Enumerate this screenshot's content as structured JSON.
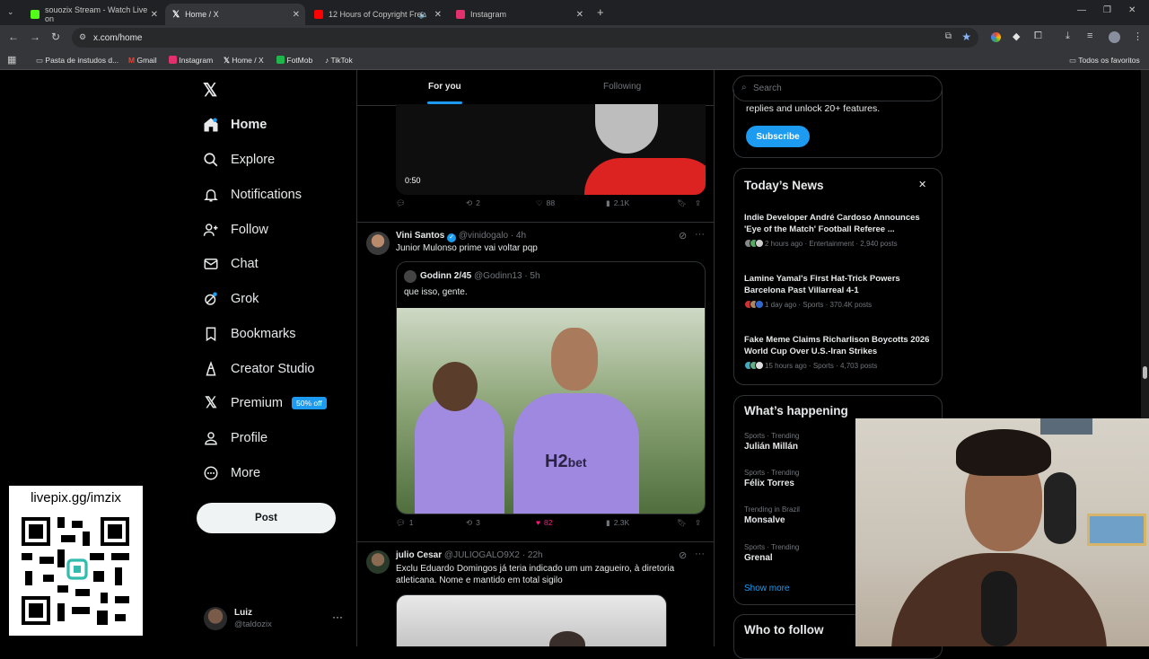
{
  "browser": {
    "tabs": [
      {
        "title": "souozix Stream - Watch Live on",
        "color": "#53fc18"
      },
      {
        "title": "Home / X",
        "color": "#ffffff"
      },
      {
        "title": "12 Hours of Copyright Free",
        "color": "#ff0000"
      },
      {
        "title": "Instagram",
        "color": "#e1306c"
      }
    ],
    "url": "x.com/home",
    "bookmarks": [
      "Pasta de instudos d...",
      "Gmail",
      "Instagram",
      "Home / X",
      "FotMob",
      "TikTok"
    ],
    "all_bookmarks": "Todos os favoritos"
  },
  "sidebar": {
    "items": [
      {
        "label": "Home",
        "icon": "home-icon"
      },
      {
        "label": "Explore",
        "icon": "search-icon"
      },
      {
        "label": "Notifications",
        "icon": "bell-icon"
      },
      {
        "label": "Follow",
        "icon": "add-user-icon"
      },
      {
        "label": "Chat",
        "icon": "mail-icon"
      },
      {
        "label": "Grok",
        "icon": "grok-icon"
      },
      {
        "label": "Bookmarks",
        "icon": "bookmark-icon"
      },
      {
        "label": "Creator Studio",
        "icon": "creator-icon"
      },
      {
        "label": "Premium",
        "icon": "x-logo-icon"
      },
      {
        "label": "Profile",
        "icon": "person-icon"
      },
      {
        "label": "More",
        "icon": "more-circle-icon"
      }
    ],
    "premium_badge": "50% off",
    "post_button": "Post",
    "user": {
      "name": "Luiz",
      "handle": "@taldozix"
    }
  },
  "overlay": {
    "livepix": "livepix.gg/imzix"
  },
  "feed": {
    "tabs": [
      "For you",
      "Following"
    ],
    "video_post": {
      "duration": "0:50",
      "replies": "",
      "reposts": "2",
      "likes": "88",
      "views": "2.1K"
    },
    "post1": {
      "name": "Vini Santos",
      "handle": "@vinidogalo",
      "time": "· 4h",
      "text": "Junior Mulonso prime vai voltar pqp",
      "quote": {
        "name": "Godinn 2/45",
        "handle": "@Godinn13",
        "time": "· 5h",
        "text": "que isso, gente."
      },
      "replies": "1",
      "reposts": "3",
      "likes": "82",
      "views": "2.3K"
    },
    "post2": {
      "name": "julio Cesar",
      "handle": "@JULIOGALO9X2",
      "time": "· 22h",
      "text": "Exclu Eduardo Domingos já teria indicado um um zagueiro, à diretoria atleticana. Nome e mantido em total sigilo"
    }
  },
  "right": {
    "search_placeholder": "Search",
    "subscribe_text": "replies and unlock 20+ features.",
    "subscribe_button": "Subscribe",
    "news_title": "Today’s News",
    "news": [
      {
        "title": "Indie Developer André Cardoso Announces 'Eye of the Match' Football Referee ...",
        "meta": "2 hours ago · Entertainment · 2,940 posts"
      },
      {
        "title": "Lamine Yamal's First Hat-Trick Powers Barcelona Past Villarreal 4-1",
        "meta": "1 day ago · Sports · 370.4K posts"
      },
      {
        "title": "Fake Meme Claims Richarlison Boycotts 2026 World Cup Over U.S.-Iran Strikes",
        "meta": "15 hours ago · Sports · 4,703 posts"
      }
    ],
    "happening_title": "What’s happening",
    "trends": [
      {
        "category": "Sports · Trending",
        "name": "Julián Millán"
      },
      {
        "category": "Sports · Trending",
        "name": "Félix Torres"
      },
      {
        "category": "Trending in Brazil",
        "name": "Monsalve"
      },
      {
        "category": "Sports · Trending",
        "name": "Grenal"
      }
    ],
    "show_more": "Show more",
    "who_to_follow": "Who to follow"
  },
  "colors": {
    "accent": "#1d9bf0",
    "like": "#f91880",
    "premium_badge": "#1d9bf0"
  }
}
